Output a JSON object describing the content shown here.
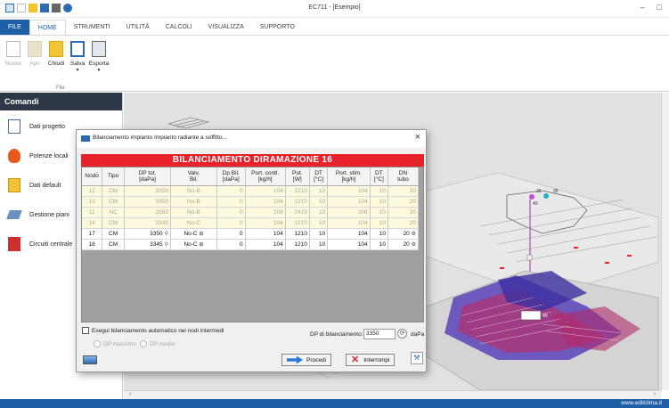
{
  "app": {
    "title": "EC711 - [Esempio]",
    "window_controls": [
      "–",
      "□"
    ]
  },
  "ribbon": {
    "tabs": [
      "FILE",
      "HOME",
      "STRUMENTI",
      "UTILITÀ",
      "CALCOLI",
      "VISUALIZZA",
      "SUPPORTO"
    ],
    "active_tab": "HOME",
    "buttons": {
      "new": "Nuovo",
      "open": "Apri",
      "close": "Chiudi",
      "save": "Salva",
      "export": "Esporta"
    },
    "group_label": "File"
  },
  "sidebar": {
    "header": "Comandi",
    "items": [
      {
        "label": "Dati progetto",
        "icon": "document-icon"
      },
      {
        "label": "Potenze locali",
        "icon": "fire-icon"
      },
      {
        "label": "Dati default",
        "icon": "defaults-icon"
      },
      {
        "label": "Gestione piani",
        "icon": "floors-icon"
      },
      {
        "label": "Circuiti centrale",
        "icon": "circuits-icon"
      }
    ]
  },
  "viewport": {
    "labels": [
      "25",
      "35",
      "40",
      "40"
    ]
  },
  "dialog": {
    "title": "Bilanciamento impianto Impianto radiante a soffitto...",
    "close_glyph": "×",
    "banner": "BILANCIAMENTO DIRAMAZIONE 16",
    "columns": [
      [
        "Nodo",
        ""
      ],
      [
        "Tipo",
        ""
      ],
      [
        "DP tot.",
        "[daPa]"
      ],
      [
        "Valv.",
        "Bil."
      ],
      [
        "Dp Bil.",
        "[daPa]"
      ],
      [
        "Port. contl.",
        "[kg/h]"
      ],
      [
        "Pot.",
        "[W]"
      ],
      [
        "DT",
        "[°C]"
      ],
      [
        "Port. stim.",
        "[kg/h]"
      ],
      [
        "DT",
        "[°C]"
      ],
      [
        "DN",
        "tubo"
      ]
    ],
    "rows": [
      {
        "nodo": "12",
        "tipo": "CM",
        "dp_tot": "3350",
        "valv": "No-B",
        "dp_bil": "0",
        "port_contl": "104",
        "pot": "1210",
        "dt1": "10",
        "port_stim": "104",
        "dt2": "10",
        "dn": "20",
        "state": "muted"
      },
      {
        "nodo": "13",
        "tipo": "CM",
        "dp_tot": "3350",
        "valv": "No-B",
        "dp_bil": "0",
        "port_contl": "104",
        "pot": "1210",
        "dt1": "10",
        "port_stim": "104",
        "dt2": "10",
        "dn": "20",
        "state": "muted"
      },
      {
        "nodo": "11",
        "tipo": "NC",
        "dp_tot": "3369",
        "valv": "No-B",
        "dp_bil": "0",
        "port_contl": "208",
        "pot": "2419",
        "dt1": "10",
        "port_stim": "208",
        "dt2": "10",
        "dn": "20",
        "state": "muted"
      },
      {
        "nodo": "14",
        "tipo": "CM",
        "dp_tot": "3345",
        "valv": "No-C",
        "dp_bil": "0",
        "port_contl": "104",
        "pot": "1210",
        "dt1": "10",
        "port_stim": "104",
        "dt2": "10",
        "dn": "20",
        "state": "muted"
      },
      {
        "nodo": "17",
        "tipo": "CM",
        "dp_tot": "3350",
        "valv": "No-C",
        "dp_bil": "0",
        "port_contl": "104",
        "pot": "1210",
        "dt1": "10",
        "port_stim": "104",
        "dt2": "10",
        "dn": "20",
        "state": "active"
      },
      {
        "nodo": "18",
        "tipo": "CM",
        "dp_tot": "3345",
        "valv": "No-C",
        "dp_bil": "0",
        "port_contl": "104",
        "pot": "1210",
        "dt1": "10",
        "port_stim": "104",
        "dt2": "10",
        "dn": "20",
        "state": "active"
      }
    ],
    "options": {
      "auto_balance_label": "Esegui bilanciamento automatico nei nodi intermedi",
      "radio_max": "DP massimo",
      "radio_mean": "DP medio",
      "dp_label": "DP di bilanciamento:",
      "dp_value": "3350",
      "dp_unit": "daPa"
    },
    "buttons": {
      "proceed": "Procedi",
      "stop": "Interrompi"
    }
  },
  "status": {
    "url": "www.edilclima.it"
  },
  "colors": {
    "accent": "#1f5fa8",
    "banner_red": "#e8222a",
    "muted_row": "#fdf9de"
  }
}
